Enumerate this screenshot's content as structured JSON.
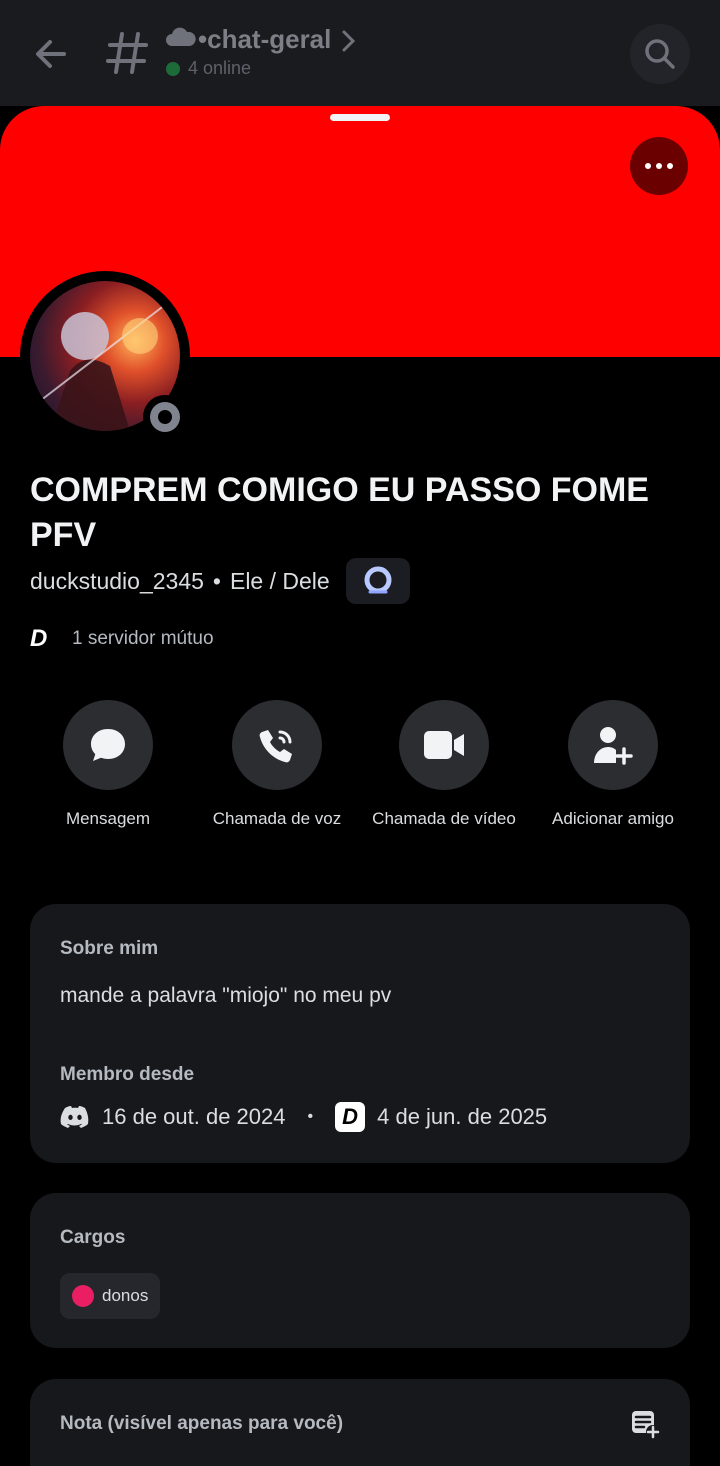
{
  "header": {
    "channel_name": "•chat-geral",
    "online_text": "4 online"
  },
  "profile": {
    "display_name": "COMPREM COMIGO EU PASSO FOME PFV",
    "username": "duckstudio_2345",
    "pronouns": "Ele / Dele",
    "mutual_servers": "1 servidor mútuo",
    "status": "offline"
  },
  "actions": [
    {
      "label": "Mensagem",
      "icon": "message-icon"
    },
    {
      "label": "Chamada de voz",
      "icon": "phone-call-icon"
    },
    {
      "label": "Chamada de vídeo",
      "icon": "video-camera-icon"
    },
    {
      "label": "Adicionar amigo",
      "icon": "add-friend-icon"
    }
  ],
  "about": {
    "title": "Sobre mim",
    "text": "mande a palavra \"miojo\" no meu pv",
    "member_since_title": "Membro desde",
    "discord_since": "16 de out. de 2024",
    "server_since": "4 de jun. de 2025"
  },
  "roles": {
    "title": "Cargos",
    "items": [
      {
        "name": "donos",
        "color": "#e91e63"
      }
    ]
  },
  "note": {
    "title": "Nota (visível apenas para você)"
  },
  "colors": {
    "banner": "#ff0000",
    "background": "#000000",
    "card": "#17181c"
  }
}
